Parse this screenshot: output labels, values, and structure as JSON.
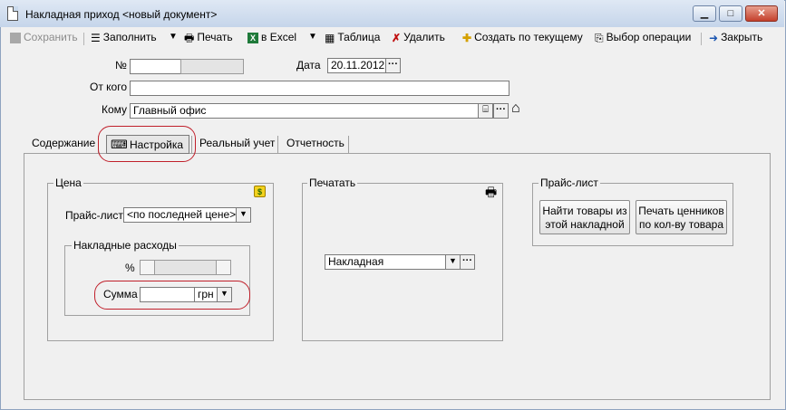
{
  "window": {
    "title": "Накладная приход <новый документ>",
    "minimize": "▁",
    "maximize": "□",
    "close": "✕"
  },
  "toolbar": {
    "save": "Сохранить",
    "fill": "Заполнить",
    "print": "Печать",
    "excel": "в Excel",
    "table": "Таблица",
    "delete": "Удалить",
    "create_from_current": "Создать по текущему",
    "select_operation": "Выбор операции",
    "close": "Закрыть"
  },
  "form": {
    "number_label": "№",
    "number_value": "",
    "date_label": "Дата",
    "date_value": "20.11.2012",
    "from_label": "От кого",
    "from_value": "",
    "to_label": "Кому",
    "to_value": "Главный офис"
  },
  "tabs": [
    {
      "label": "Содержание"
    },
    {
      "label": "Настройка"
    },
    {
      "label": "Реальный учет"
    },
    {
      "label": "Отчетность"
    }
  ],
  "price_group": {
    "title": "Цена",
    "pricelist_label": "Прайс-лист",
    "pricelist_value": "<по последней цене>",
    "overhead_title": "Накладные расходы",
    "percent_label": "%",
    "sum_label": "Сумма",
    "sum_value": "",
    "currency": "грн"
  },
  "print_group": {
    "title": "Печатать",
    "doc_value": "Накладная"
  },
  "pricelist_group": {
    "title": "Прайс-лист",
    "find_button": "Найти товары из этой накладной",
    "print_tags_button": "Печать ценников по кол-ву товара"
  }
}
